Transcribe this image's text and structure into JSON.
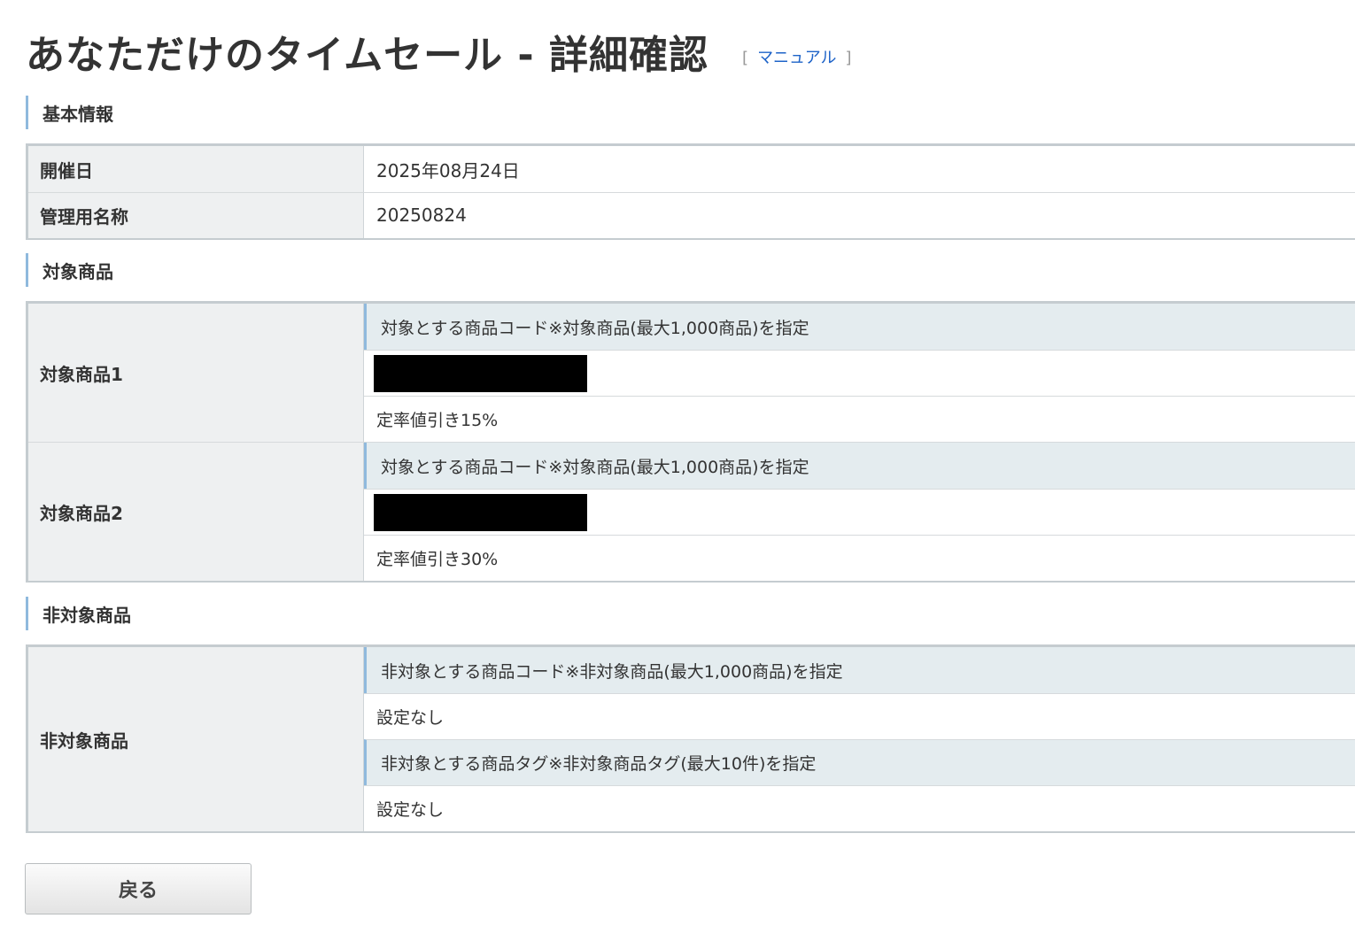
{
  "page": {
    "title": "あなただけのタイムセール - 詳細確認",
    "manual_open": "[",
    "manual_label": "マニュアル",
    "manual_close": "]"
  },
  "basic_info": {
    "heading": "基本情報",
    "rows": [
      {
        "label": "開催日",
        "value": "2025年08月24日"
      },
      {
        "label": "管理用名称",
        "value": "20250824"
      }
    ]
  },
  "target_products": {
    "heading": "対象商品",
    "items": [
      {
        "label": "対象商品1",
        "code_header": "対象とする商品コード※対象商品(最大1,000商品)を指定",
        "discount": "定率値引き15%"
      },
      {
        "label": "対象商品2",
        "code_header": "対象とする商品コード※対象商品(最大1,000商品)を指定",
        "discount": "定率値引き30%"
      }
    ]
  },
  "non_target": {
    "heading": "非対象商品",
    "label": "非対象商品",
    "code_header": "非対象とする商品コード※非対象商品(最大1,000商品)を指定",
    "code_value": "設定なし",
    "tag_header": "非対象とする商品タグ※非対象商品タグ(最大10件)を指定",
    "tag_value": "設定なし"
  },
  "back_button": {
    "label": "戻る"
  }
}
